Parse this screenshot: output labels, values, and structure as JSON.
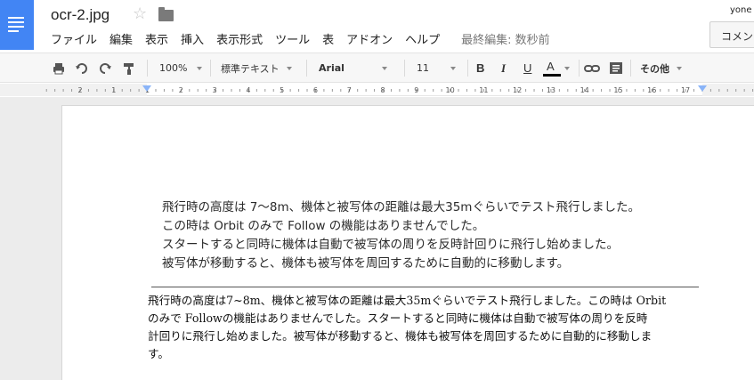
{
  "header": {
    "doc_title": "ocr-2.jpg",
    "user": "yone",
    "comment_button": "コメン",
    "last_edit": "最終編集: 数秒前"
  },
  "menu": [
    "ファイル",
    "編集",
    "表示",
    "挿入",
    "表示形式",
    "ツール",
    "表",
    "アドオン",
    "ヘルプ"
  ],
  "toolbar": {
    "zoom": "100%",
    "style": "標準テキスト",
    "font": "Arial",
    "size": "11",
    "bold": "B",
    "italic": "I",
    "underline": "U",
    "text_color": "A",
    "more": "その他",
    "text_color_value": "#000000"
  },
  "ruler": {
    "labels": [
      "2",
      "1",
      "1",
      "2",
      "3",
      "4",
      "5",
      "6",
      "7",
      "8",
      "9",
      "10",
      "11",
      "12",
      "13",
      "14",
      "15",
      "16",
      "17"
    ]
  },
  "document": {
    "image_lines": [
      "飛行時の高度は 7～8m、機体と被写体の距離は最大35mぐらいでテスト飛行しました。",
      "この時は Orbit のみで Follow の機能はありませんでした。",
      "スタートすると同時に機体は自動で被写体の周りを反時計回りに飛行し始めました。",
      "被写体が移動すると、機体も被写体を周回するために自動的に移動します。"
    ],
    "ocr_lines": [
      "飛行時の高度は7~8m、機体と被写体の距離は最大35mぐらいでテスト飛行しました。この時は Orbit",
      "のみで Followの機能はありませんでした。スタートすると同時に機体は自動で被写体の周りを反時",
      "計回りに飛行し始めました。被写体が移動すると、機体も被写体を周回するために自動的に移動しま",
      "す。"
    ]
  },
  "colors": {
    "brand_blue": "#4285f4",
    "ruler_marker": "#8ab4f8"
  }
}
